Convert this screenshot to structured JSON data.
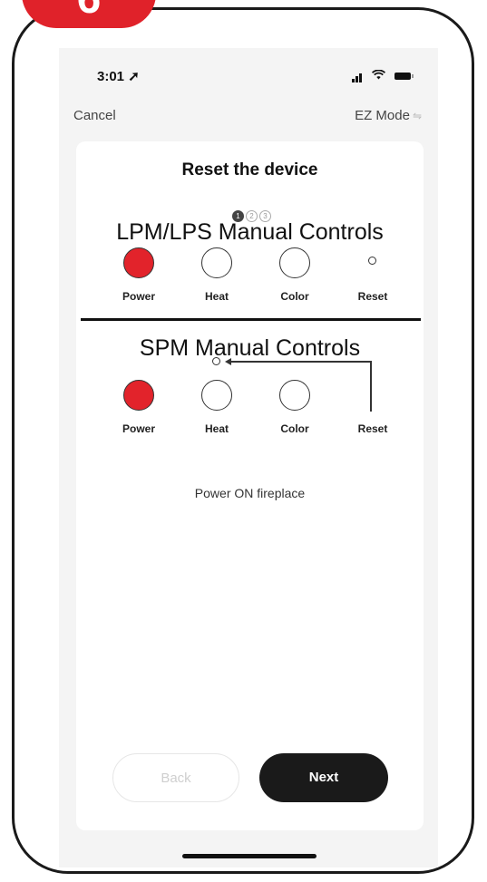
{
  "step_badge": "6",
  "status_bar": {
    "time": "3:01",
    "location_glyph": "➚"
  },
  "nav": {
    "cancel_label": "Cancel",
    "mode_label": "EZ Mode",
    "mode_icon": "⇋"
  },
  "card": {
    "title": "Reset the device",
    "steps": [
      "1",
      "2",
      "3"
    ],
    "active_step": 1,
    "lpm_section": {
      "title": "LPM/LPS Manual Controls",
      "controls": [
        "Power",
        "Heat",
        "Color",
        "Reset"
      ]
    },
    "spm_section": {
      "title": "SPM Manual Controls",
      "controls": [
        "Power",
        "Heat",
        "Color",
        "Reset"
      ]
    },
    "instruction": "Power ON fireplace",
    "back_label": "Back",
    "next_label": "Next"
  },
  "colors": {
    "accent_red": "#e2232b",
    "badge_red": "#e0222a",
    "next_button": "#1a1a1a"
  }
}
